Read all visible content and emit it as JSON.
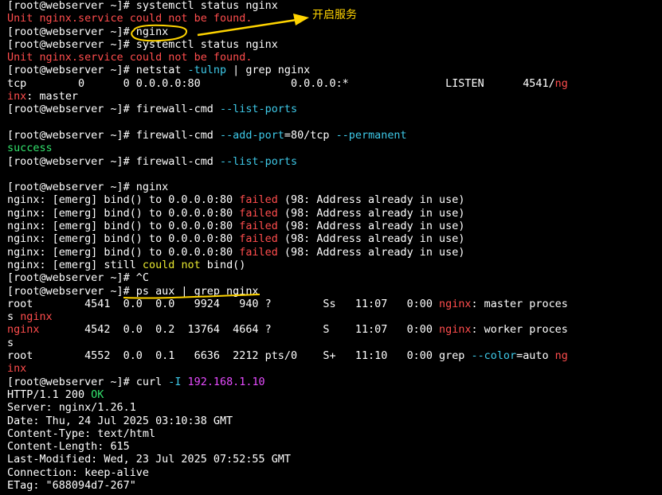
{
  "colors": {
    "default": "#ffffff",
    "red": "#ff4d4d",
    "cyan": "#3ec9e8",
    "green": "#33e36d",
    "magenta": "#e64bff",
    "yellow": "#e8e830",
    "annotation": "#ffd400"
  },
  "lines": [
    [
      {
        "t": "[root@webserver ~]# systemctl status nginx"
      }
    ],
    [
      {
        "t": "Unit nginx.service could not be found.",
        "c": "red"
      }
    ],
    [
      {
        "t": "[root@webserver ~]# nginx"
      }
    ],
    [
      {
        "t": "[root@webserver ~]# systemctl status nginx"
      }
    ],
    [
      {
        "t": "Unit nginx.service could not be found.",
        "c": "red"
      }
    ],
    [
      {
        "t": "[root@webserver ~]# netstat "
      },
      {
        "t": "-tulnp",
        "c": "cyan"
      },
      {
        "t": " | grep nginx"
      }
    ],
    [
      {
        "t": "tcp        0      0 0.0.0.0:80              0.0.0.0:*               LISTEN      4541/"
      },
      {
        "t": "ng",
        "c": "red"
      }
    ],
    [
      {
        "t": "inx",
        "c": "red"
      },
      {
        "t": ": master"
      }
    ],
    [
      {
        "t": "[root@webserver ~]# firewall-cmd "
      },
      {
        "t": "--list-ports",
        "c": "cyan"
      }
    ],
    [
      {
        "t": ""
      }
    ],
    [
      {
        "t": "[root@webserver ~]# firewall-cmd "
      },
      {
        "t": "--add-port",
        "c": "cyan"
      },
      {
        "t": "=80/tcp "
      },
      {
        "t": "--permanent",
        "c": "cyan"
      }
    ],
    [
      {
        "t": "success",
        "c": "green"
      }
    ],
    [
      {
        "t": "[root@webserver ~]# firewall-cmd "
      },
      {
        "t": "--list-ports",
        "c": "cyan"
      }
    ],
    [
      {
        "t": ""
      }
    ],
    [
      {
        "t": "[root@webserver ~]# nginx"
      }
    ],
    [
      {
        "t": "nginx: [emerg] bind() to 0.0.0.0:80 "
      },
      {
        "t": "failed",
        "c": "red"
      },
      {
        "t": " (98: Address already in use)"
      }
    ],
    [
      {
        "t": "nginx: [emerg] bind() to 0.0.0.0:80 "
      },
      {
        "t": "failed",
        "c": "red"
      },
      {
        "t": " (98: Address already in use)"
      }
    ],
    [
      {
        "t": "nginx: [emerg] bind() to 0.0.0.0:80 "
      },
      {
        "t": "failed",
        "c": "red"
      },
      {
        "t": " (98: Address already in use)"
      }
    ],
    [
      {
        "t": "nginx: [emerg] bind() to 0.0.0.0:80 "
      },
      {
        "t": "failed",
        "c": "red"
      },
      {
        "t": " (98: Address already in use)"
      }
    ],
    [
      {
        "t": "nginx: [emerg] bind() to 0.0.0.0:80 "
      },
      {
        "t": "failed",
        "c": "red"
      },
      {
        "t": " (98: Address already in use)"
      }
    ],
    [
      {
        "t": "nginx: [emerg] still "
      },
      {
        "t": "could not",
        "c": "yellow"
      },
      {
        "t": " bind()"
      }
    ],
    [
      {
        "t": "[root@webserver ~]# ^C"
      }
    ],
    [
      {
        "t": "[root@webserver ~]# ps aux | grep nginx"
      }
    ],
    [
      {
        "t": "root        4541  0.0  0.0   9924   940 ?        Ss   11:07   0:00 "
      },
      {
        "t": "nginx",
        "c": "red"
      },
      {
        "t": ": master proces"
      }
    ],
    [
      {
        "t": "s "
      },
      {
        "t": "nginx",
        "c": "red"
      }
    ],
    [
      {
        "t": "nginx",
        "c": "red"
      },
      {
        "t": "       4542  0.0  0.2  13764  4664 ?        S    11:07   0:00 "
      },
      {
        "t": "nginx",
        "c": "red"
      },
      {
        "t": ": worker proces"
      }
    ],
    [
      {
        "t": "s"
      }
    ],
    [
      {
        "t": "root        4552  0.0  0.1   6636  2212 pts/0    S+   11:10   0:00 grep "
      },
      {
        "t": "--color",
        "c": "cyan"
      },
      {
        "t": "=auto "
      },
      {
        "t": "ng",
        "c": "red"
      }
    ],
    [
      {
        "t": "inx",
        "c": "red"
      }
    ],
    [
      {
        "t": "[root@webserver ~]# curl "
      },
      {
        "t": "-I",
        "c": "cyan"
      },
      {
        "t": " "
      },
      {
        "t": "192.168.1.10",
        "c": "magenta"
      }
    ],
    [
      {
        "t": "HTTP/1.1 200 "
      },
      {
        "t": "OK",
        "c": "green"
      }
    ],
    [
      {
        "t": "Server: nginx/1.26.1"
      }
    ],
    [
      {
        "t": "Date: Thu, 24 Jul 2025 03:10:38 GMT"
      }
    ],
    [
      {
        "t": "Content-Type: text/html"
      }
    ],
    [
      {
        "t": "Content-Length: 615"
      }
    ],
    [
      {
        "t": "Last-Modified: Wed, 23 Jul 2025 07:52:55 GMT"
      }
    ],
    [
      {
        "t": "Connection: keep-alive"
      }
    ],
    [
      {
        "t": "ETag: \"688094d7-267\""
      }
    ]
  ],
  "annotation": {
    "label": "开启服务"
  }
}
